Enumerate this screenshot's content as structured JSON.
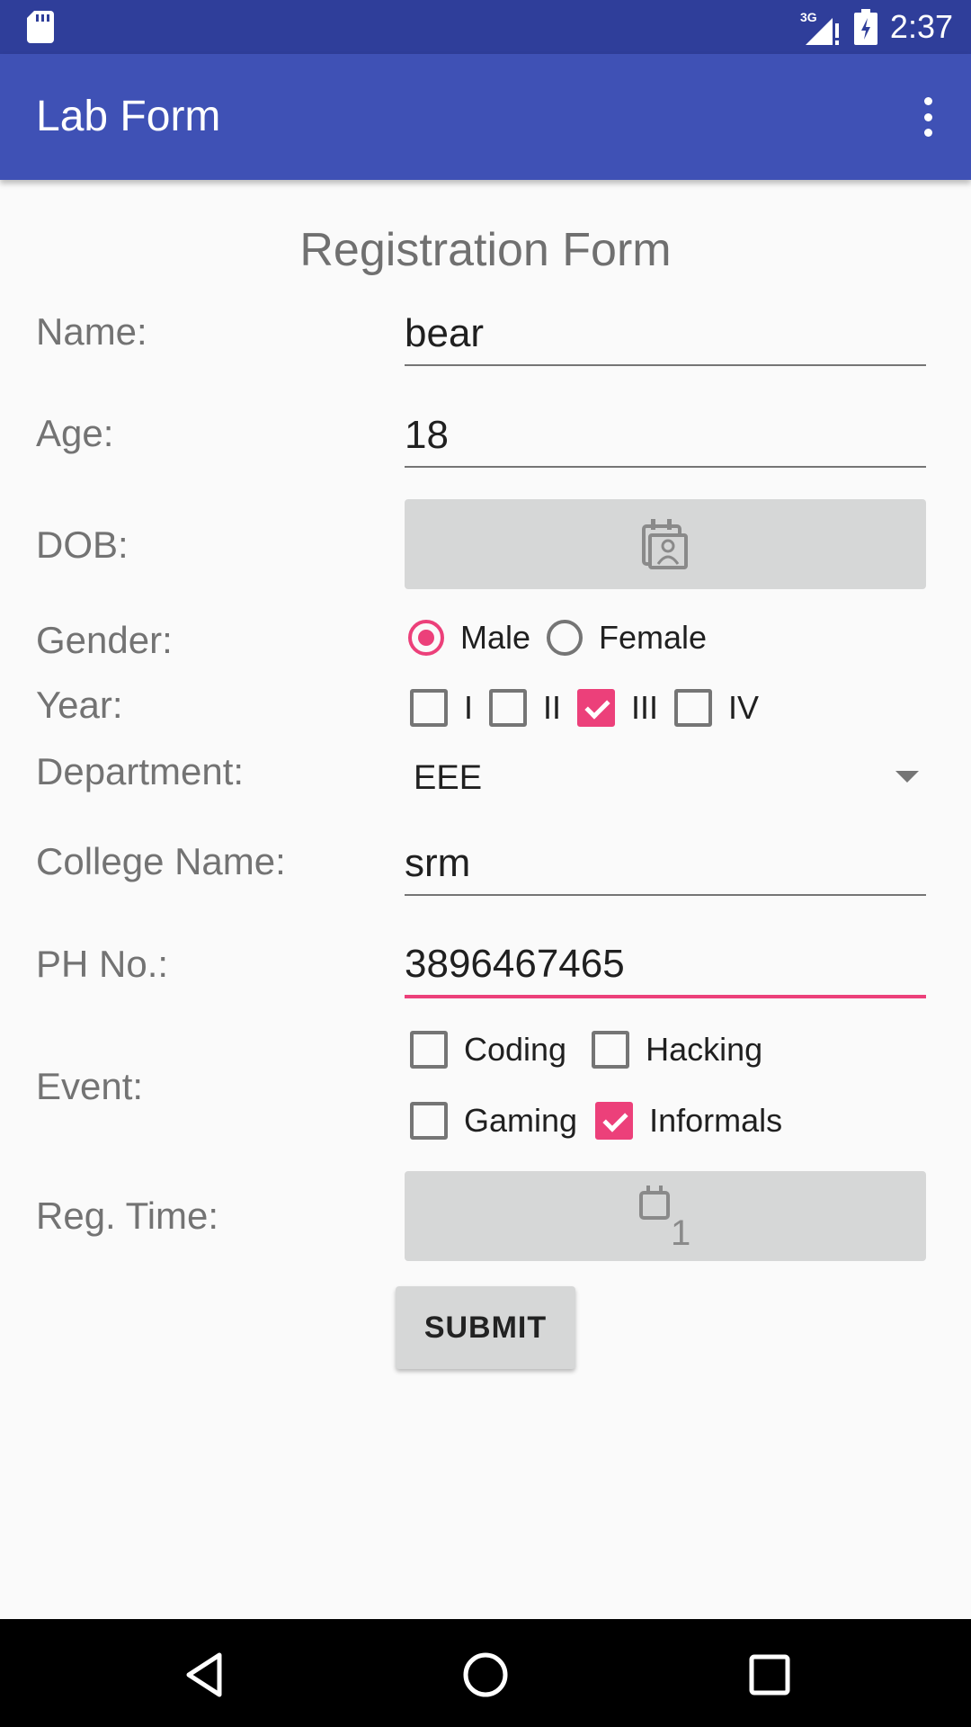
{
  "status_bar": {
    "time": "2:37",
    "network": "3G",
    "icons": [
      "sd-card-icon",
      "signal-icon",
      "battery-icon"
    ]
  },
  "app_bar": {
    "title": "Lab Form",
    "overflow_icon": "more-vert-icon"
  },
  "form": {
    "title": "Registration Form",
    "name": {
      "label": "Name:",
      "value": "bear"
    },
    "age": {
      "label": "Age:",
      "value": "18"
    },
    "dob": {
      "label": "DOB:",
      "icon": "calendar-icon"
    },
    "gender": {
      "label": "Gender:",
      "options": [
        {
          "label": "Male",
          "selected": true
        },
        {
          "label": "Female",
          "selected": false
        }
      ]
    },
    "year": {
      "label": "Year:",
      "options": [
        {
          "label": "I",
          "checked": false
        },
        {
          "label": "II",
          "checked": false
        },
        {
          "label": "III",
          "checked": true
        },
        {
          "label": "IV",
          "checked": false
        }
      ]
    },
    "department": {
      "label": "Department:",
      "value": "EEE"
    },
    "college": {
      "label": "College Name:",
      "value": "srm"
    },
    "phone": {
      "label": "PH No.:",
      "value": "3896467465"
    },
    "event": {
      "label": "Event:",
      "options": [
        {
          "label": "Coding",
          "checked": false
        },
        {
          "label": "Hacking",
          "checked": false
        },
        {
          "label": "Gaming",
          "checked": false
        },
        {
          "label": "Informals",
          "checked": true
        }
      ]
    },
    "reg_time": {
      "label": "Reg. Time:",
      "icon": "time-icon"
    },
    "submit_label": "SUBMIT"
  },
  "colors": {
    "status_bar": "#2f3e9a",
    "app_bar": "#3f51b5",
    "accent": "#ec407a"
  }
}
